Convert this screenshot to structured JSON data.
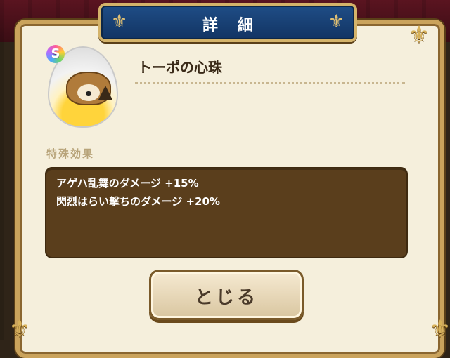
{
  "header": {
    "title": "詳細"
  },
  "item": {
    "rarity_badge": "S",
    "name": "トーポの心珠",
    "icon": "mole-egg-icon"
  },
  "effects": {
    "section_label": "特殊効果",
    "lines": [
      "アゲハ乱舞のダメージ +15%",
      "閃烈はらい撃ちのダメージ +20%"
    ]
  },
  "actions": {
    "close_label": "とじる"
  },
  "colors": {
    "title_plate": "#1f4d86",
    "panel_bg": "#f5efdc",
    "frame_gold": "#caa35c",
    "effects_bg": "#5a3e1c"
  }
}
